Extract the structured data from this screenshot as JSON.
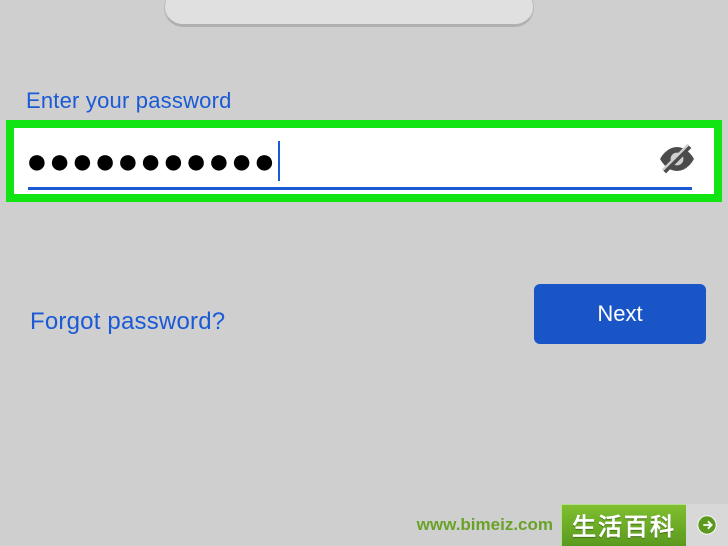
{
  "label": "Enter your password",
  "password_masked": "●●●●●●●●●●●",
  "forgot": "Forgot password?",
  "next": "Next",
  "watermark": {
    "badge": "生活百科",
    "url": "www.bimeiz.com"
  }
}
